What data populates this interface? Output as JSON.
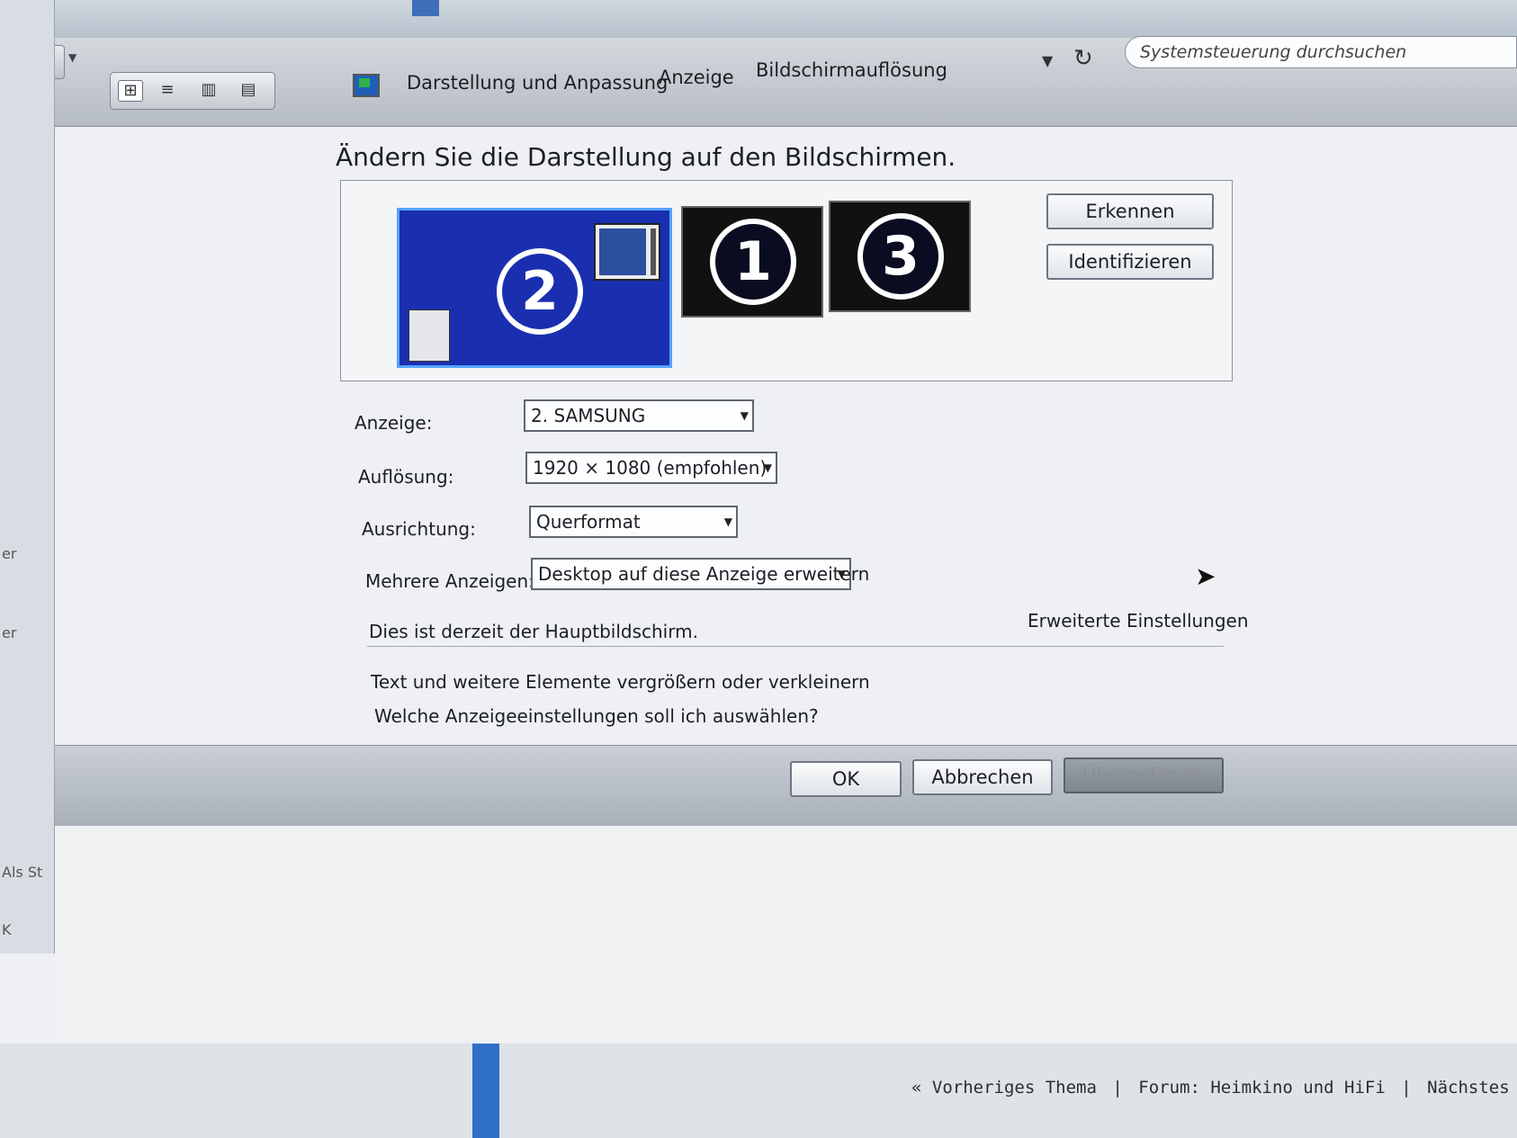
{
  "toolbar": {
    "breadcrumb": [
      "Darstellung und Anpassung",
      "Anzeige",
      "Bildschirmauflösung"
    ],
    "search_placeholder": "Systemsteuerung durchsuchen"
  },
  "page": {
    "heading": "Ändern Sie die Darstellung auf den Bildschirmen.",
    "monitors": [
      "2",
      "1",
      "3"
    ],
    "detect_button": "Erkennen",
    "identify_button": "Identifizieren"
  },
  "form": {
    "display_label": "Anzeige:",
    "display_value": "2. SAMSUNG",
    "resolution_label": "Auflösung:",
    "resolution_value": "1920 × 1080 (empfohlen)",
    "orientation_label": "Ausrichtung:",
    "orientation_value": "Querformat",
    "multi_label": "Mehrere Anzeigen:",
    "multi_value": "Desktop auf diese Anzeige erweitern"
  },
  "info": {
    "main_display_text": "Dies ist derzeit der Hauptbildschirm.",
    "advanced_link": "Erweiterte Einstellungen",
    "resize_link": "Text und weitere Elemente vergrößern oder verkleinern",
    "help_link": "Welche Anzeigeeinstellungen soll ich auswählen?"
  },
  "footer": {
    "ok": "OK",
    "cancel": "Abbrechen",
    "apply": "Übernehmen"
  },
  "left_window": {
    "frag1": "er",
    "frag2": "er",
    "frag3": "Als St",
    "frag4": "K"
  },
  "forum_nav": {
    "prev": "« Vorheriges Thema",
    "sep": "|",
    "forum": "Forum: Heimkino und HiFi",
    "next": "Nächstes Thema »"
  }
}
